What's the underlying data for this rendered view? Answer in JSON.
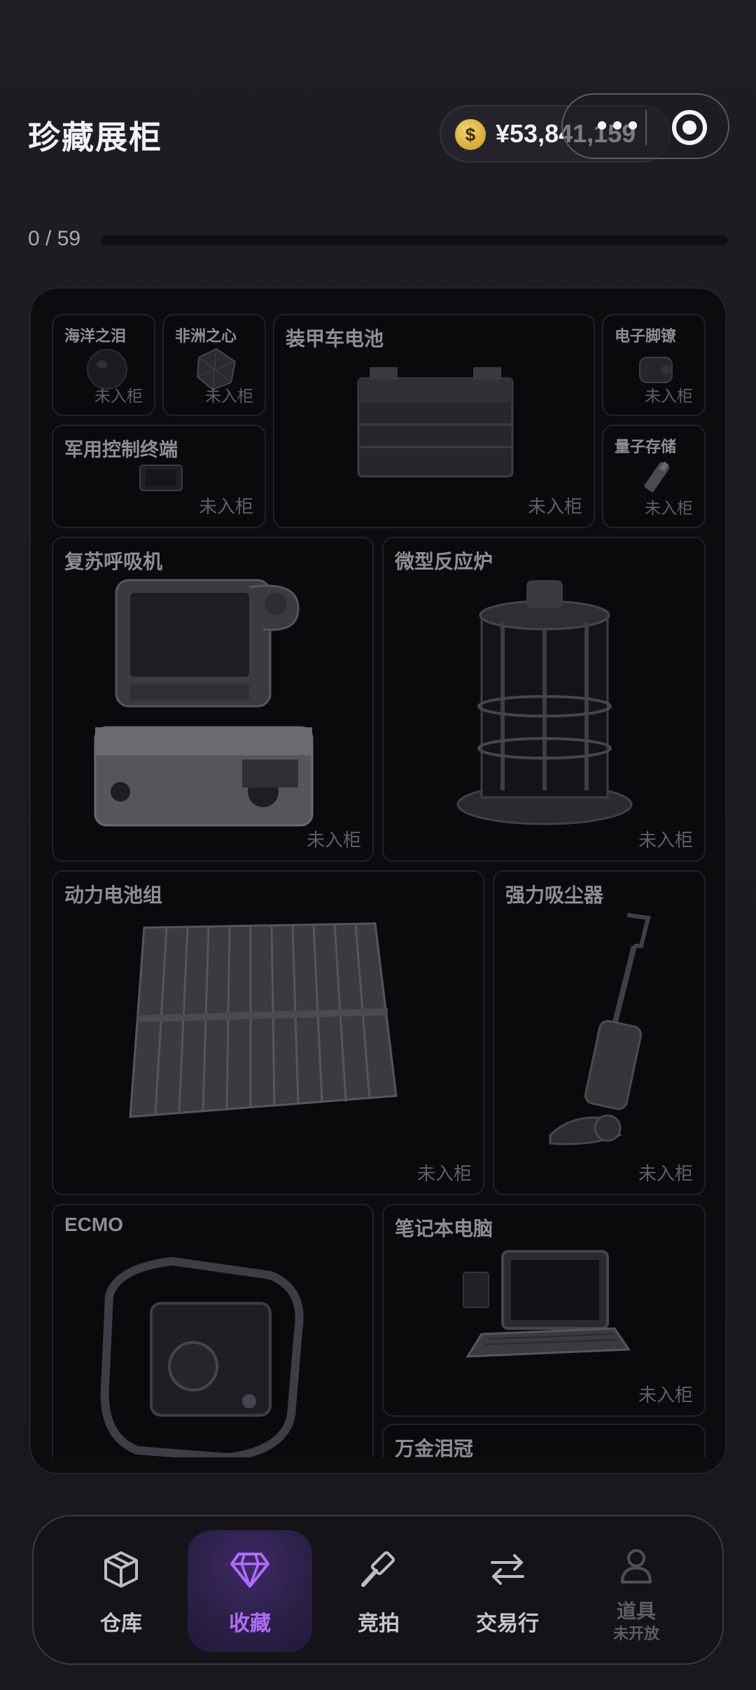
{
  "header": {
    "title": "珍藏展柜",
    "balance": "¥53,841,159",
    "coin_icon": "$"
  },
  "progress": {
    "label": "0 / 59",
    "collected": 0,
    "total": 59
  },
  "items": [
    {
      "name": "海洋之泪",
      "status": "未入柜"
    },
    {
      "name": "非洲之心",
      "status": "未入柜"
    },
    {
      "name": "装甲车电池",
      "status": "未入柜"
    },
    {
      "name": "电子脚镣",
      "status": "未入柜"
    },
    {
      "name": "军用控制终端",
      "status": "未入柜"
    },
    {
      "name": "量子存储",
      "status": "未入柜"
    },
    {
      "name": "复苏呼吸机",
      "status": "未入柜"
    },
    {
      "name": "微型反应炉",
      "status": "未入柜"
    },
    {
      "name": "动力电池组",
      "status": "未入柜"
    },
    {
      "name": "强力吸尘器",
      "status": "未入柜"
    },
    {
      "name": "ECMO",
      "status": ""
    },
    {
      "name": "笔记本电脑",
      "status": "未入柜"
    },
    {
      "name": "万金泪冠",
      "status": ""
    }
  ],
  "tabs": [
    {
      "label": "仓库",
      "icon": "box-icon"
    },
    {
      "label": "收藏",
      "icon": "diamond-icon",
      "active": true
    },
    {
      "label": "竞拍",
      "icon": "gavel-icon"
    },
    {
      "label": "交易行",
      "icon": "swap-arrows-icon"
    },
    {
      "label": "道具",
      "sublabel": "未开放",
      "icon": "person-icon",
      "disabled": true
    }
  ],
  "colors": {
    "accent": "#b06cff",
    "background": "#1c1b20",
    "coin": "#d9aa35"
  }
}
